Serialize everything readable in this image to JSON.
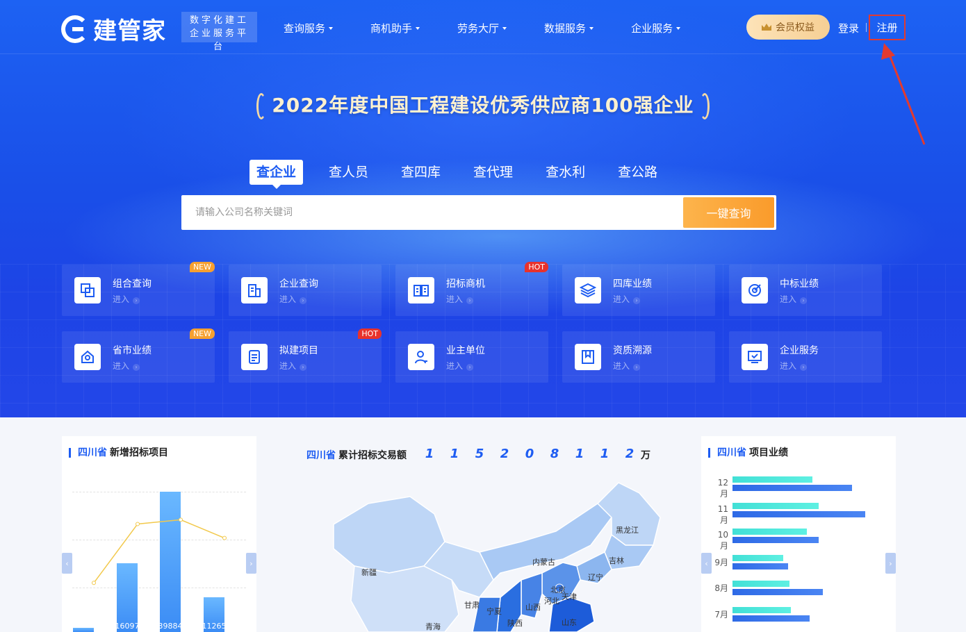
{
  "header": {
    "logo_text": "建管家",
    "tagline_line1": "数字化建工",
    "tagline_line2": "企业服务平台",
    "nav": [
      {
        "label": "查询服务"
      },
      {
        "label": "商机助手"
      },
      {
        "label": "劳务大厅"
      },
      {
        "label": "数据服务"
      },
      {
        "label": "企业服务"
      }
    ],
    "member_label": "会员权益",
    "login_label": "登录",
    "register_label": "注册"
  },
  "hero": {
    "title": "2022年度中国工程建设优秀供应商100强企业"
  },
  "search": {
    "tabs": [
      "查企业",
      "查人员",
      "查四库",
      "查代理",
      "查水利",
      "查公路"
    ],
    "active_tab": "查企业",
    "placeholder": "请输入公司名称关键词",
    "button_label": "一键查询"
  },
  "services": [
    {
      "title": "组合查询",
      "sub": "进入",
      "badge": "NEW",
      "icon": "layers-copy-icon"
    },
    {
      "title": "企业查询",
      "sub": "进入",
      "badge": "",
      "icon": "building-icon"
    },
    {
      "title": "招标商机",
      "sub": "进入",
      "badge": "HOT",
      "icon": "open-book-icon"
    },
    {
      "title": "四库业绩",
      "sub": "进入",
      "badge": "",
      "icon": "stack-icon"
    },
    {
      "title": "中标业绩",
      "sub": "进入",
      "badge": "",
      "icon": "target-icon"
    },
    {
      "title": "省市业绩",
      "sub": "进入",
      "badge": "NEW",
      "icon": "home-badge-icon"
    },
    {
      "title": "拟建项目",
      "sub": "进入",
      "badge": "HOT",
      "icon": "document-icon"
    },
    {
      "title": "业主单位",
      "sub": "进入",
      "badge": "",
      "icon": "user-icon"
    },
    {
      "title": "资质溯源",
      "sub": "进入",
      "badge": "",
      "icon": "bookmark-icon"
    },
    {
      "title": "企业服务",
      "sub": "进入",
      "badge": "",
      "icon": "monitor-check-icon"
    }
  ],
  "panels": {
    "province": "四川省",
    "new_bids_title": "新增招标项目",
    "total_title": "累计招标交易额",
    "total_digits": [
      "1",
      "1",
      "5",
      "2",
      "0",
      "8",
      "1",
      "1",
      "2"
    ],
    "total_unit": "万",
    "performance_title": "项目业绩"
  },
  "chart_data": [
    {
      "type": "bar",
      "title": "四川省 新增招标项目",
      "bar_values": [
        0.03,
        0.49,
        1.0,
        0.25
      ],
      "bar_labels": [
        "",
        "16097",
        "39884",
        "11265"
      ],
      "line_values": [
        0.35,
        0.77,
        0.8,
        0.67
      ],
      "note": "partially cropped chart; values shown as relative fractions of the chart height"
    },
    {
      "type": "bar",
      "title": "四川省 项目业绩",
      "orientation": "horizontal",
      "categories": [
        "12月",
        "11月",
        "10月",
        "9月",
        "8月",
        "7月"
      ],
      "series": [
        {
          "values": [
            0.6,
            0.65,
            0.56,
            0.38,
            0.43,
            0.44
          ]
        },
        {
          "values": [
            0.9,
            1.0,
            0.65,
            0.42,
            0.68,
            0.58
          ]
        }
      ]
    }
  ],
  "map": {
    "labels": [
      "黑龙江",
      "吉林",
      "辽宁",
      "内蒙古",
      "北京",
      "天津",
      "河北",
      "山西",
      "山东",
      "新疆",
      "甘肃",
      "宁夏",
      "陕西",
      "青海"
    ]
  },
  "colors": {
    "brand_blue": "#1d5cf2",
    "accent_orange": "#fa9b2b",
    "hot_red": "#e8322c",
    "new_orange": "#f6a030"
  }
}
